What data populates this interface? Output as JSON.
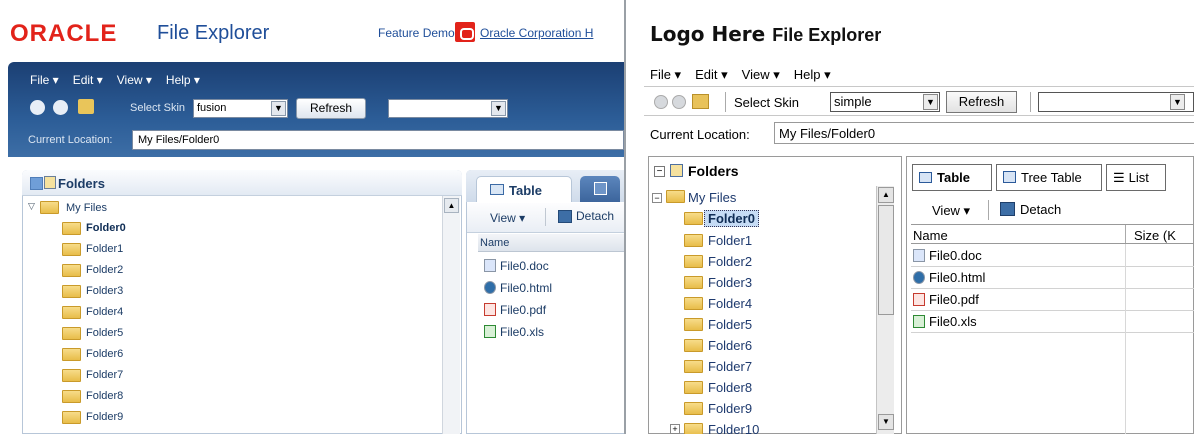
{
  "left": {
    "brand": "ORACLE",
    "title": "File Explorer",
    "feature_demos": "Feature Demos",
    "oracle_link": "Oracle Corporation H",
    "menu": [
      "File ▾",
      "Edit ▾",
      "View ▾",
      "Help ▾"
    ],
    "toolbar": {
      "skin_label": "Select Skin",
      "skin_value": "fusion",
      "refresh_label": "Refresh"
    },
    "location": {
      "label": "Current Location:",
      "value": "My Files/Folder0"
    },
    "tree": {
      "heading": "Folders",
      "root": "My Files",
      "items": [
        "Folder0",
        "Folder1",
        "Folder2",
        "Folder3",
        "Folder4",
        "Folder5",
        "Folder6",
        "Folder7",
        "Folder8",
        "Folder9"
      ]
    },
    "tabs": {
      "table_label": "Table"
    },
    "table_toolbar": {
      "view_label": "View ▾",
      "detach_label": "Detach"
    },
    "table": {
      "header": "Name",
      "files": [
        "File0.doc",
        "File0.html",
        "File0.pdf",
        "File0.xls"
      ]
    }
  },
  "right": {
    "logo": "Logo Here",
    "title": "File Explorer",
    "menu": [
      "File ▾",
      "Edit ▾",
      "View ▾",
      "Help ▾"
    ],
    "toolbar": {
      "skin_label": "Select Skin",
      "skin_value": "simple",
      "refresh_label": "Refresh"
    },
    "location": {
      "label": "Current Location:",
      "value": "My Files/Folder0"
    },
    "tree": {
      "heading": "Folders",
      "root": "My Files",
      "items": [
        "Folder0",
        "Folder1",
        "Folder2",
        "Folder3",
        "Folder4",
        "Folder5",
        "Folder6",
        "Folder7",
        "Folder8",
        "Folder9",
        "Folder10"
      ]
    },
    "tabs": [
      "Table",
      "Tree Table",
      "List"
    ],
    "table_toolbar": {
      "view_label": "View ▾",
      "detach_label": "Detach"
    },
    "table": {
      "headers": [
        "Name",
        "Size (K"
      ],
      "files": [
        "File0.doc",
        "File0.html",
        "File0.pdf",
        "File0.xls"
      ]
    }
  },
  "colors": {
    "oracle_red": "#e2231a",
    "fusion_band": "#2c5d97",
    "link_blue": "#1f4e99",
    "selected_blue": "#c6dcf5"
  }
}
